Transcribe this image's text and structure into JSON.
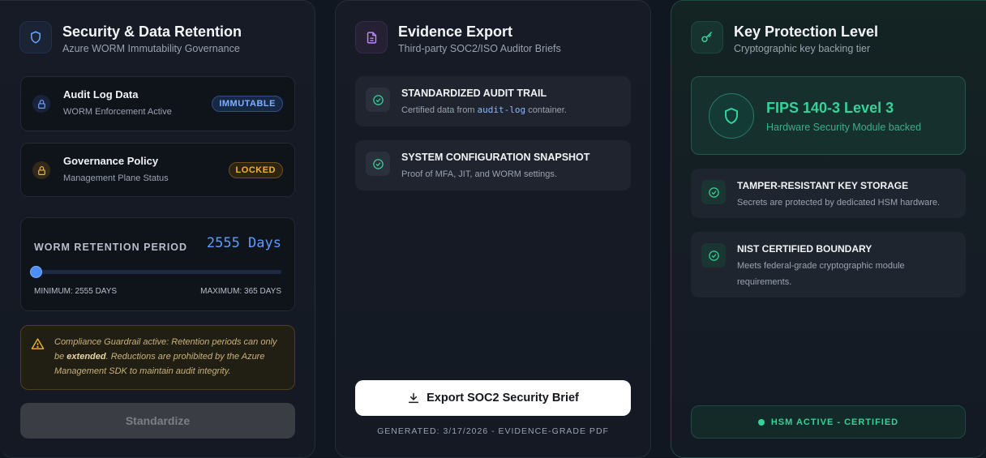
{
  "security": {
    "title": "Security & Data Retention",
    "subtitle": "Azure WORM Immutability Governance",
    "audit": {
      "title": "Audit Log Data",
      "subtitle": "WORM Enforcement Active",
      "badge": "IMMUTABLE"
    },
    "policy": {
      "title": "Governance Policy",
      "subtitle": "Management Plane Status",
      "badge": "LOCKED"
    },
    "retention": {
      "label": "WORM RETENTION PERIOD",
      "value": "2555 Days",
      "min_label": "MINIMUM: 2555 DAYS",
      "max_label": "MAXIMUM: 365 DAYS",
      "slider_fraction": 0
    },
    "warning": {
      "part1": "Compliance Guardrail active: Retention periods can only be ",
      "emphasis": "extended",
      "part2": ". Reductions are prohibited by the Azure Management SDK to maintain audit integrity."
    },
    "button": "Standardize"
  },
  "evidence": {
    "title": "Evidence Export",
    "subtitle": "Third-party SOC2/ISO Auditor Briefs",
    "item1": {
      "title": "STANDARDIZED AUDIT TRAIL",
      "sub_pre": "Certified data from ",
      "sub_code": "audit-log",
      "sub_post": " container."
    },
    "item2": {
      "title": "SYSTEM CONFIGURATION SNAPSHOT",
      "sub": "Proof of MFA, JIT, and WORM settings."
    },
    "export_button": "Export SOC2 Security Brief",
    "generated": "GENERATED: 3/17/2026 - EVIDENCE-GRADE PDF"
  },
  "keyprot": {
    "title": "Key Protection Level",
    "subtitle": "Cryptographic key backing tier",
    "level_title": "FIPS 140-3 Level 3",
    "level_sub": "Hardware Security Module backed",
    "item1": {
      "title": "TAMPER-RESISTANT KEY STORAGE",
      "sub": "Secrets are protected by dedicated HSM hardware."
    },
    "item2": {
      "title": "NIST CERTIFIED BOUNDARY",
      "sub": "Meets federal-grade cryptographic module requirements."
    },
    "status": "HSM ACTIVE - CERTIFIED"
  },
  "colors": {
    "blue_accent": "#5b9dff",
    "amber_accent": "#f0b232",
    "green_accent": "#34d399",
    "purple_accent": "#b98cf5"
  }
}
